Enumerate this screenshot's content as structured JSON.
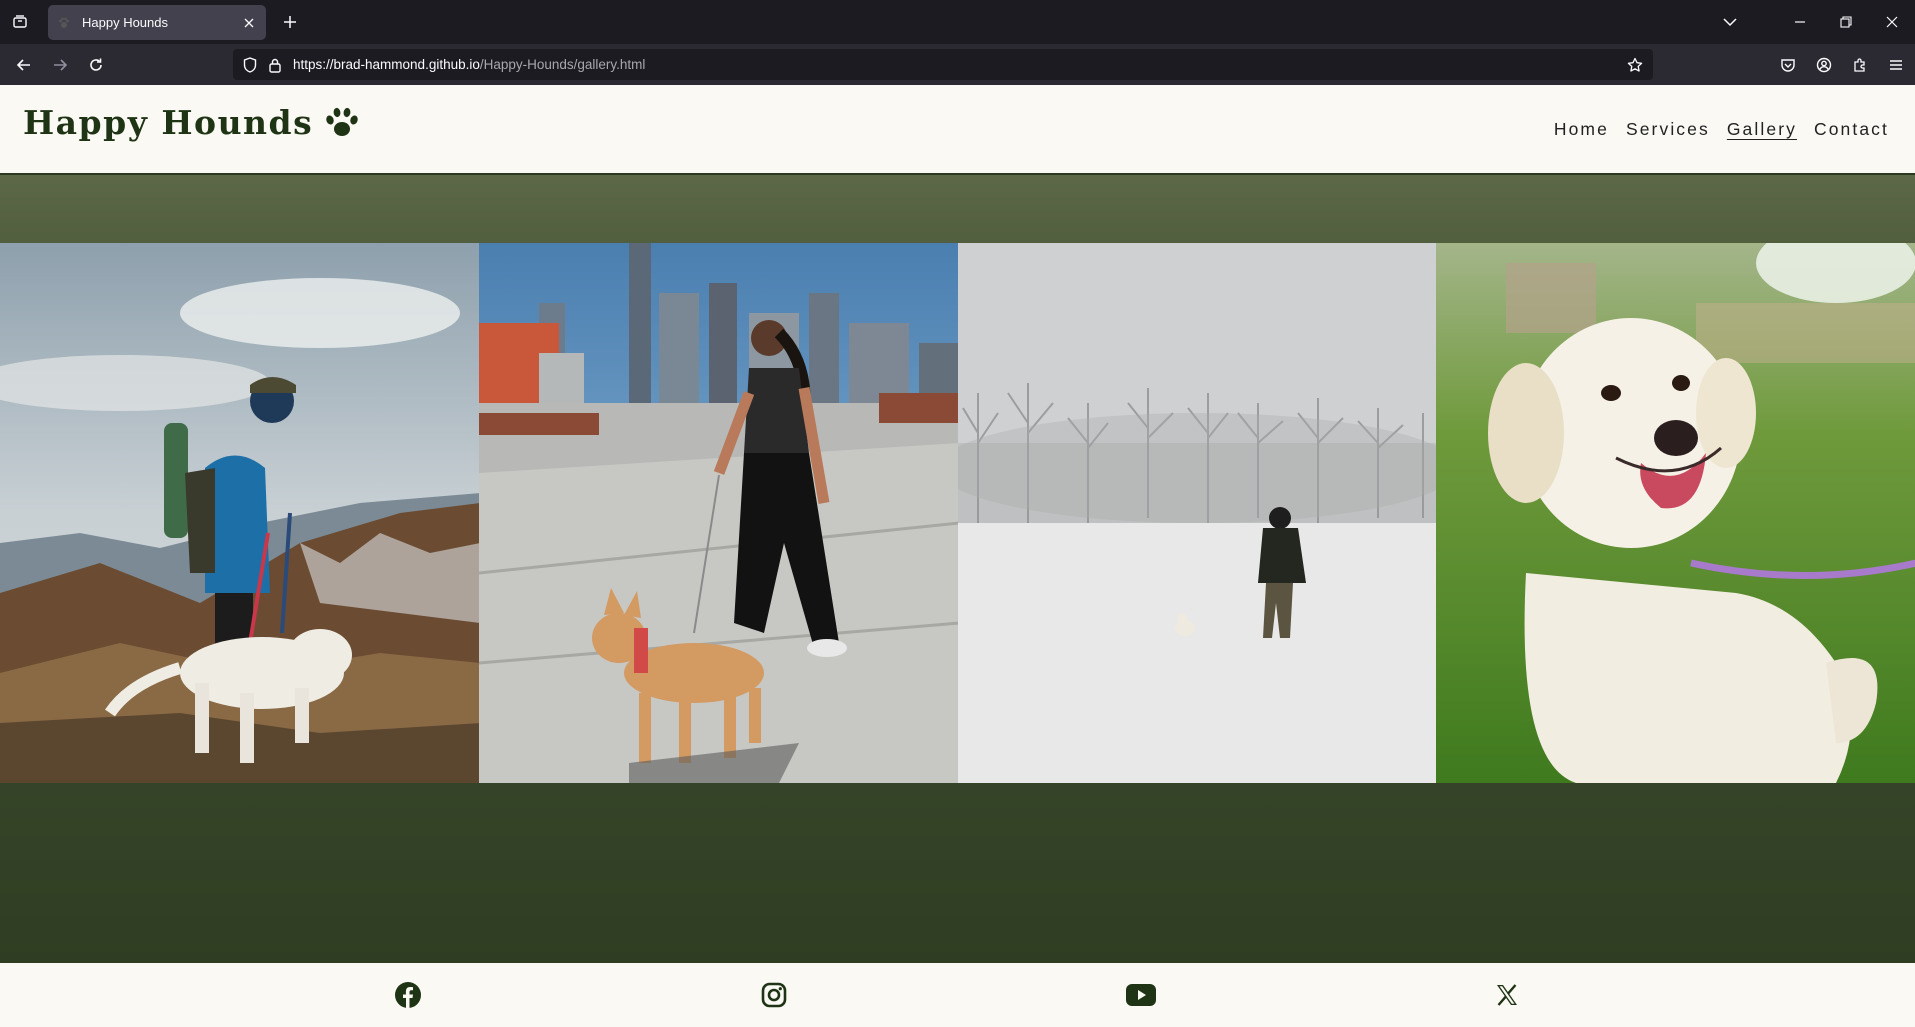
{
  "browser": {
    "tab_title": "Happy Hounds",
    "url_host": "https://brad-hammond.github.io",
    "url_path": "/Happy-Hounds/gallery.html"
  },
  "site": {
    "logo_text": "Happy Hounds",
    "logo_icon": "paw-icon",
    "nav": [
      {
        "label": "Home"
      },
      {
        "label": "Services"
      },
      {
        "label": "Gallery"
      },
      {
        "label": "Contact"
      }
    ],
    "active_nav": "Gallery"
  },
  "gallery": {
    "photos": [
      {
        "subject": "hiker-with-white-dog-on-mountain"
      },
      {
        "subject": "woman-walking-dog-on-rooftop-city"
      },
      {
        "subject": "person-walking-small-dog-in-snow"
      },
      {
        "subject": "golden-retriever-on-leash-grass"
      }
    ]
  },
  "footer": {
    "social": [
      "facebook-icon",
      "instagram-icon",
      "youtube-icon",
      "x-icon"
    ]
  },
  "colors": {
    "header_bg": "#faf9f4",
    "logo": "#1f3414",
    "hero_top": "#5c6847",
    "hero_bottom": "#2f3d22",
    "browser_chrome": "#1c1b22"
  }
}
